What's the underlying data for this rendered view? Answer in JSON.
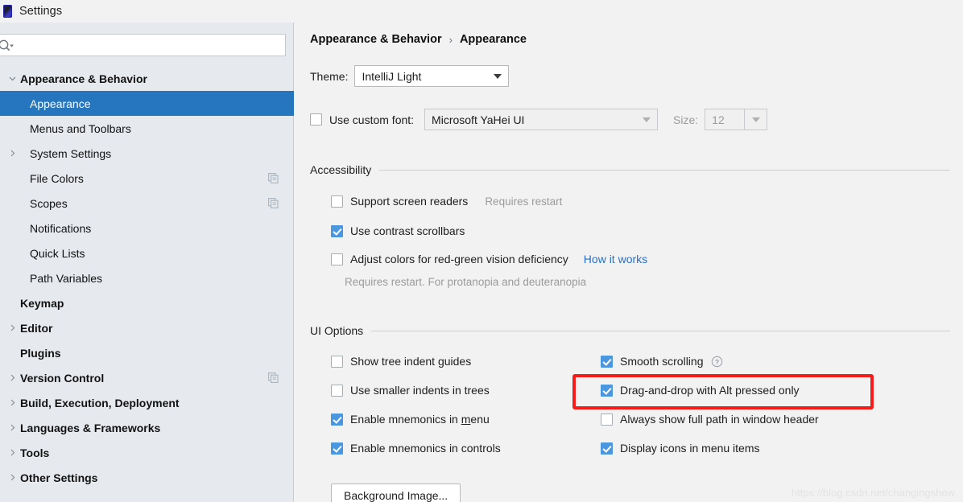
{
  "window": {
    "title": "Settings",
    "icon": "intellij-logo-icon"
  },
  "sidebar": {
    "search": {
      "placeholder": "",
      "value": "",
      "icon": "search-icon"
    },
    "items": [
      {
        "label": "Appearance & Behavior",
        "level": 0,
        "arrow": "v",
        "selected": false,
        "bold": true,
        "copy": false
      },
      {
        "label": "Appearance",
        "level": 1,
        "arrow": "",
        "selected": true,
        "bold": false,
        "copy": false
      },
      {
        "label": "Menus and Toolbars",
        "level": 1,
        "arrow": "",
        "selected": false,
        "bold": false,
        "copy": false
      },
      {
        "label": "System Settings",
        "level": 1,
        "arrow": ">",
        "selected": false,
        "bold": false,
        "copy": false
      },
      {
        "label": "File Colors",
        "level": 1,
        "arrow": "",
        "selected": false,
        "bold": false,
        "copy": true
      },
      {
        "label": "Scopes",
        "level": 1,
        "arrow": "",
        "selected": false,
        "bold": false,
        "copy": true
      },
      {
        "label": "Notifications",
        "level": 1,
        "arrow": "",
        "selected": false,
        "bold": false,
        "copy": false
      },
      {
        "label": "Quick Lists",
        "level": 1,
        "arrow": "",
        "selected": false,
        "bold": false,
        "copy": false
      },
      {
        "label": "Path Variables",
        "level": 1,
        "arrow": "",
        "selected": false,
        "bold": false,
        "copy": false
      },
      {
        "label": "Keymap",
        "level": 0,
        "arrow": "",
        "selected": false,
        "bold": true,
        "copy": false
      },
      {
        "label": "Editor",
        "level": 0,
        "arrow": ">",
        "selected": false,
        "bold": true,
        "copy": false
      },
      {
        "label": "Plugins",
        "level": 0,
        "arrow": "",
        "selected": false,
        "bold": true,
        "copy": false
      },
      {
        "label": "Version Control",
        "level": 0,
        "arrow": ">",
        "selected": false,
        "bold": true,
        "copy": true
      },
      {
        "label": "Build, Execution, Deployment",
        "level": 0,
        "arrow": ">",
        "selected": false,
        "bold": true,
        "copy": false
      },
      {
        "label": "Languages & Frameworks",
        "level": 0,
        "arrow": ">",
        "selected": false,
        "bold": true,
        "copy": false
      },
      {
        "label": "Tools",
        "level": 0,
        "arrow": ">",
        "selected": false,
        "bold": true,
        "copy": false
      },
      {
        "label": "Other Settings",
        "level": 0,
        "arrow": ">",
        "selected": false,
        "bold": true,
        "copy": false
      }
    ]
  },
  "main": {
    "breadcrumb": {
      "parent": "Appearance & Behavior",
      "separator": "›",
      "current": "Appearance"
    },
    "theme": {
      "label": "Theme:",
      "value": "IntelliJ Light"
    },
    "custom_font": {
      "checkbox_label": "Use custom font:",
      "checked": false,
      "value": "Microsoft YaHei UI",
      "size_label": "Size:",
      "size_value": "12",
      "size_disabled": true
    },
    "accessibility": {
      "title": "Accessibility",
      "options": [
        {
          "label": "Support screen readers",
          "checked": false,
          "hint": "Requires restart"
        },
        {
          "label": "Use contrast scrollbars",
          "checked": true,
          "hint": ""
        },
        {
          "label": "Adjust colors for red-green vision deficiency",
          "checked": false,
          "link": "How it works"
        }
      ],
      "footnote": "Requires restart. For protanopia and deuteranopia"
    },
    "ui_options": {
      "title": "UI Options",
      "left_column": [
        {
          "label": "Show tree indent guides",
          "checked": false
        },
        {
          "label": "Use smaller indents in trees",
          "checked": false
        },
        {
          "label_pre": "Enable mnemonics in ",
          "mnemonic": "m",
          "label_post": "enu",
          "label": "Enable mnemonics in menu",
          "checked": true
        },
        {
          "label": "Enable mnemonics in controls",
          "checked": true
        }
      ],
      "right_column": [
        {
          "label": "Smooth scrolling",
          "checked": true,
          "help_icon": "help-circle-icon"
        },
        {
          "label": "Drag-and-drop with Alt pressed only",
          "checked": true,
          "highlighted": true
        },
        {
          "label": "Always show full path in window header",
          "checked": false
        },
        {
          "label": "Display icons in menu items",
          "checked": true
        }
      ],
      "background_image_button": "Background Image..."
    }
  },
  "watermark": "https://blog.csdn.net/changingshow",
  "colors": {
    "accent": "#2675bf",
    "checkbox_on": "#4a97e0",
    "highlight": "#f51b1b",
    "link": "#2a70c4",
    "sidebar_bg": "#e6eaee",
    "main_bg": "#f2f2f2"
  }
}
